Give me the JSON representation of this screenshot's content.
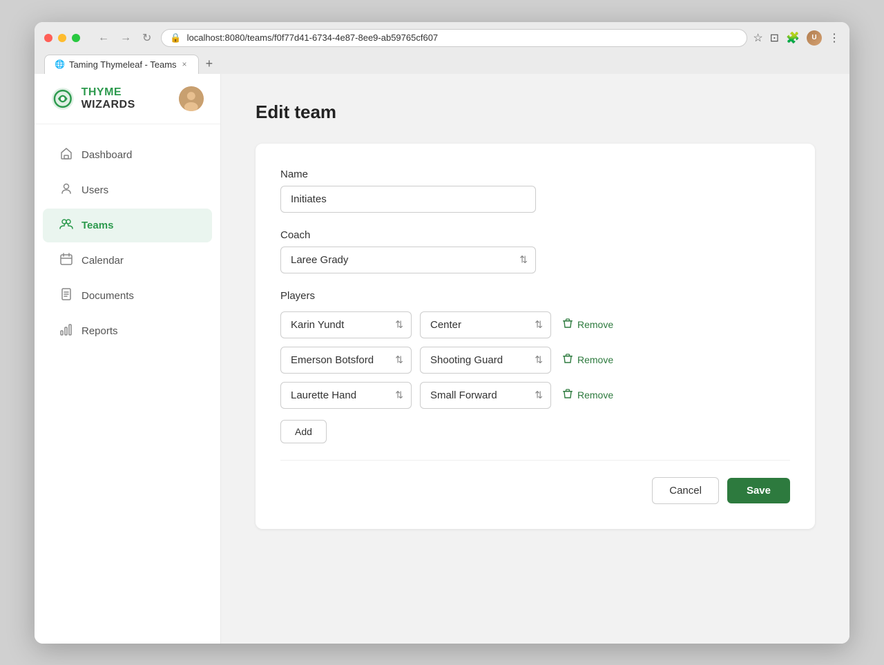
{
  "browser": {
    "tab_title": "Taming Thymeleaf - Teams",
    "url": "localhost:8080/teams/f0f77d41-6734-4e87-8ee9-ab59765cf607",
    "tab_close": "×",
    "tab_new": "+"
  },
  "app": {
    "logo_thyme": "THYME",
    "logo_wizards": "WIZARDS"
  },
  "sidebar": {
    "nav_items": [
      {
        "id": "dashboard",
        "label": "Dashboard",
        "icon": "🏠"
      },
      {
        "id": "users",
        "label": "Users",
        "icon": "👤"
      },
      {
        "id": "teams",
        "label": "Teams",
        "icon": "👥",
        "active": true
      },
      {
        "id": "calendar",
        "label": "Calendar",
        "icon": "📅"
      },
      {
        "id": "documents",
        "label": "Documents",
        "icon": "📄"
      },
      {
        "id": "reports",
        "label": "Reports",
        "icon": "📊"
      }
    ]
  },
  "page": {
    "title": "Edit team"
  },
  "form": {
    "name_label": "Name",
    "name_value": "Initiates",
    "coach_label": "Coach",
    "coach_value": "Laree Grady",
    "players_label": "Players",
    "players": [
      {
        "name": "Karin Yundt",
        "position": "Center"
      },
      {
        "name": "Emerson Botsford",
        "position": "Shooting Guard"
      },
      {
        "name": "Laurette Hand",
        "position": "Small Forward"
      }
    ],
    "add_label": "Add",
    "cancel_label": "Cancel",
    "save_label": "Save"
  }
}
